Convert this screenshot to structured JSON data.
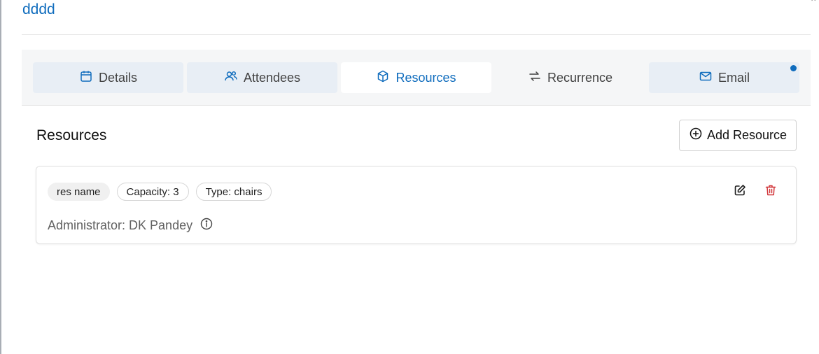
{
  "page": {
    "title": "dddd"
  },
  "tabs": [
    {
      "label": "Details",
      "icon": "calendar-icon",
      "state": "inactive"
    },
    {
      "label": "Attendees",
      "icon": "people-icon",
      "state": "inactive"
    },
    {
      "label": "Resources",
      "icon": "cube-icon",
      "state": "active"
    },
    {
      "label": "Recurrence",
      "icon": "arrow-repeat-icon",
      "state": "plain"
    },
    {
      "label": "Email",
      "icon": "mail-icon",
      "state": "inactive",
      "has_indicator": true
    }
  ],
  "resources": {
    "heading": "Resources",
    "add_label": "Add Resource",
    "items": [
      {
        "name": "res name",
        "capacity": "Capacity: 3",
        "type": "Type: chairs",
        "administrator": "Administrator: DK Pandey"
      }
    ]
  },
  "colors": {
    "accent": "#0f6cbd",
    "delete": "#d13438",
    "tab_inactive_bg": "#e8eef5",
    "tabbar_bg": "#f5f6f7"
  }
}
